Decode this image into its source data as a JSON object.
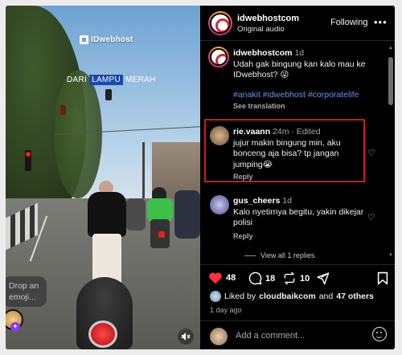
{
  "video": {
    "brand_logo": "IDwebhost",
    "overlay_caption": {
      "before": "DARI",
      "highlight": "LAMPU",
      "after": "MERAH"
    },
    "emoji_prompt": "Drop an emoji...",
    "mute_icon": "speaker-muted-icon"
  },
  "header": {
    "username": "idwebhostcom",
    "subtitle": "Original audio",
    "follow_label": "Following",
    "more_icon": "•••"
  },
  "caption": {
    "username": "idwebhostcom",
    "time": "1d",
    "text": "Udah gak bingung kan kalo mau ke IDwebhost? 😜",
    "hashtags": "#anakit #idwebhost #corporatelife",
    "see_translation": "See translation"
  },
  "comments": [
    {
      "username": "rie.vaann",
      "meta": "24m · Edited",
      "text": "jujur makin bingung min, aku bonceng aja bisa? tp jangan jumping😭",
      "reply_label": "Reply",
      "highlighted": true
    },
    {
      "username": "gus_cheers",
      "meta": "1d",
      "text": "Kalo nyetirnya begitu, yakin dikejar polisi",
      "reply_label": "Reply",
      "view_replies": "View all 1 replies"
    }
  ],
  "actions": {
    "likes": "48",
    "comments": "18",
    "reposts": "10"
  },
  "liked_by": {
    "prefix": "Liked by",
    "user": "cloudbaikcom",
    "and": "and",
    "others": "47 others"
  },
  "posted_ago": "1 day ago",
  "add_comment": {
    "placeholder": "Add a comment..."
  },
  "colors": {
    "like_red": "#ff3040",
    "hashtag_blue": "#6b93e8",
    "highlight_border": "#d41818"
  }
}
